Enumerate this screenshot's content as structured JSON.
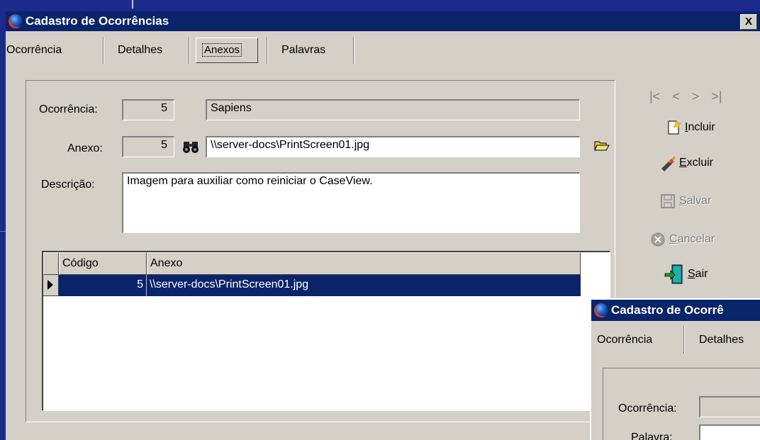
{
  "main_window": {
    "title": "Cadastro de Ocorrências",
    "close_label": "X",
    "tabs": [
      {
        "label": "Ocorrência"
      },
      {
        "label": "Detalhes"
      },
      {
        "label": "Anexos"
      },
      {
        "label": "Palavras"
      }
    ],
    "form": {
      "ocorrencia_label": "Ocorrência:",
      "ocorrencia_id": "5",
      "ocorrencia_name": "Sapiens",
      "anexo_label": "Anexo:",
      "anexo_id": "5",
      "anexo_path": "\\\\server-docs\\PrintScreen01.jpg",
      "descricao_label": "Descrição:",
      "descricao_value": "Imagem para auxiliar como reiniciar o CaseView."
    },
    "grid": {
      "columns": [
        "Código",
        "Anexo"
      ],
      "rows": [
        {
          "codigo": "5",
          "anexo": "\\\\server-docs\\PrintScreen01.jpg"
        }
      ]
    },
    "nav": {
      "first": "|<",
      "prev": "<",
      "next": ">",
      "last": ">|"
    },
    "actions": {
      "incluir": {
        "pre": "",
        "key": "I",
        "rest": "ncluir"
      },
      "excluir": {
        "pre": "",
        "key": "E",
        "rest": "xcluir"
      },
      "salvar": {
        "pre": "",
        "key": "S",
        "rest": "alvar"
      },
      "cancelar": {
        "pre": "",
        "key": "C",
        "rest": "ancelar"
      },
      "sair": {
        "pre": "",
        "key": "S",
        "rest": "air"
      }
    }
  },
  "second_window": {
    "title": "Cadastro de Ocorrê",
    "tabs": [
      {
        "label": "Ocorrência"
      },
      {
        "label": "Detalhes"
      }
    ],
    "form": {
      "ocorrencia_label": "Ocorrência:",
      "palavra_label": "Palavra:"
    }
  },
  "colors": {
    "desktop": "#1b2a8c",
    "titlebar": "#0a246a",
    "face": "#d4d0c8",
    "selection": "#0a246a"
  }
}
